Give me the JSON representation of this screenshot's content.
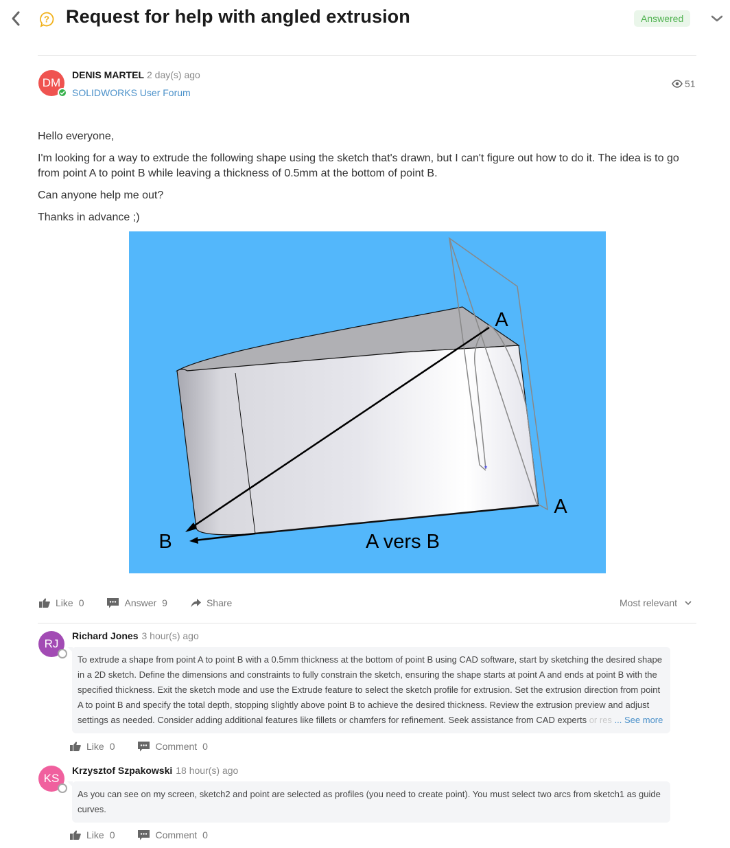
{
  "header": {
    "title": "Request for help with angled extrusion",
    "status_badge": "Answered",
    "icons": {
      "back": "chevron-left-icon",
      "question": "question-bubble-icon",
      "collapse": "chevron-down-icon"
    }
  },
  "post": {
    "author": {
      "initials": "DM",
      "name": "DENIS MARTEL",
      "time": "2 day(s) ago",
      "avatar_color": "#ef5350",
      "status": "verified"
    },
    "forum": "SOLIDWORKS User Forum",
    "views": "51",
    "paragraphs": [
      "Hello everyone,",
      "I'm looking for a way to extrude the following shape using the sketch that's drawn, but I can't figure out how to do it. The idea is to go from point A to point B while leaving a thickness of 0.5mm at the bottom of point B.",
      "Can anyone help me out?",
      "Thanks in advance ;)"
    ],
    "figure": {
      "labels": {
        "a_top": "A",
        "a_bottom": "A",
        "b": "B",
        "direction": "A vers B"
      },
      "background_color": "#53b7fb"
    },
    "actions": {
      "like_label": "Like",
      "like_count": "0",
      "answer_label": "Answer",
      "answer_count": "9",
      "share_label": "Share"
    },
    "sort": "Most relevant"
  },
  "comments": [
    {
      "initials": "RJ",
      "name": "Richard Jones",
      "time": "3 hour(s) ago",
      "avatar_color": "#a24bb4",
      "text_main": "To extrude a shape from point A to point B with a 0.5mm thickness at the bottom of point B using CAD software, start by sketching the desired shape in a 2D sketch. Define the dimensions and constraints to fully constrain the sketch, ensuring the shape starts at point A and ends at point B with the specified thickness. Exit the sketch mode and use the Extrude feature to select the sketch profile for extrusion. Set the extrusion direction from point A to point B and specify the total depth, stopping slightly above point B to achieve the desired thickness. Review the extrusion preview and adjust settings as needed. Consider adding additional features like fillets or chamfers for refinement. Seek assistance from CAD experts",
      "text_fade": " or res",
      "see_more": "... See more",
      "like_label": "Like",
      "like_count": "0",
      "comment_label": "Comment",
      "comment_count": "0"
    },
    {
      "initials": "KS",
      "name": "Krzysztof Szpakowski",
      "time": "18 hour(s) ago",
      "avatar_color": "#f0609e",
      "text_main": "As you can see on my screen, sketch2 and point are selected as profiles (you need to create point). You must select two arcs from sketch1 as guide curves.",
      "like_label": "Like",
      "like_count": "0",
      "comment_label": "Comment",
      "comment_count": "0"
    }
  ]
}
